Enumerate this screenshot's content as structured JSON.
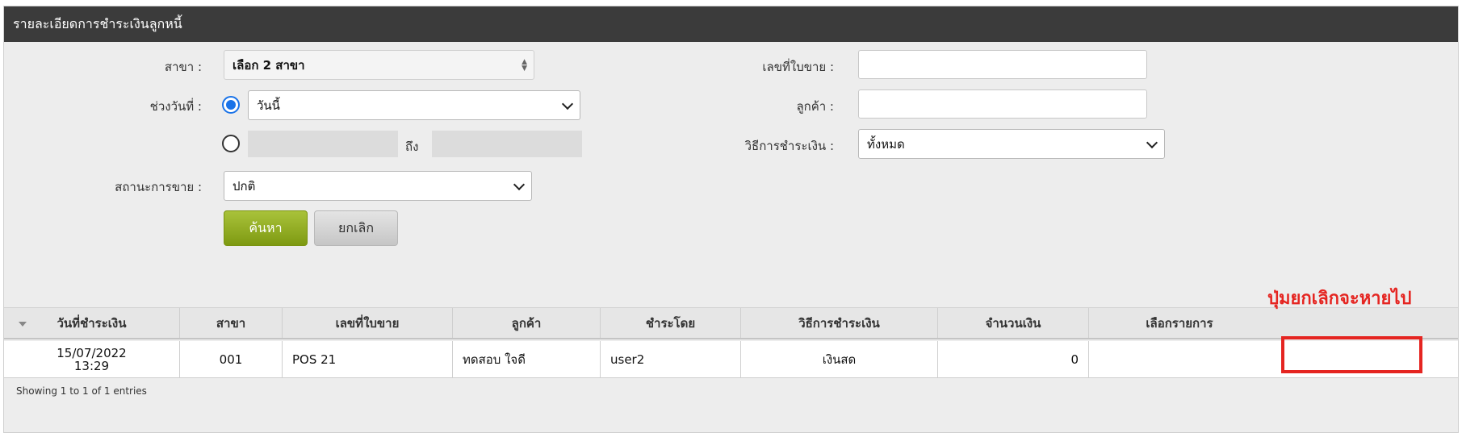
{
  "panel": {
    "title": "รายละเอียดการชำระเงินลูกหนี้"
  },
  "filters": {
    "branch_label": "สาขา :",
    "branch_value": "เลือก 2 สาขา",
    "date_range_label": "ช่วงวันที่ :",
    "date_preset_value": "วันนี้",
    "date_to_label": "ถึง",
    "sale_status_label": "สถานะการขาย :",
    "sale_status_value": "ปกติ",
    "invoice_label": "เลขที่ใบขาย :",
    "invoice_value": "",
    "customer_label": "ลูกค้า :",
    "customer_value": "",
    "payment_method_label": "วิธีการชำระเงิน :",
    "payment_method_value": "ทั้งหมด"
  },
  "buttons": {
    "search": "ค้นหา",
    "cancel": "ยกเลิก"
  },
  "table": {
    "columns": [
      "วันที่ชำระเงิน",
      "สาขา",
      "เลขที่ใบขาย",
      "ลูกค้า",
      "ชำระโดย",
      "วิธีการชำระเงิน",
      "จำนวนเงิน",
      "เลือกรายการ"
    ],
    "rows": [
      {
        "date": "15/07/2022",
        "time": "13:29",
        "branch": "001",
        "invoice": "POS 21",
        "customer": "ทดสอบ ใจดี",
        "paid_by": "user2",
        "payment_method": "เงินสด",
        "amount": "0"
      }
    ],
    "info": "Showing 1 to 1 of 1 entries"
  },
  "annotation": {
    "text": "ปุ่มยกเลิกจะหายไป",
    "color": "#e52521"
  },
  "colors": {
    "header_bg": "#3b3b3b",
    "search_button": "#8aa51e",
    "radio_active": "#1a73e8"
  }
}
